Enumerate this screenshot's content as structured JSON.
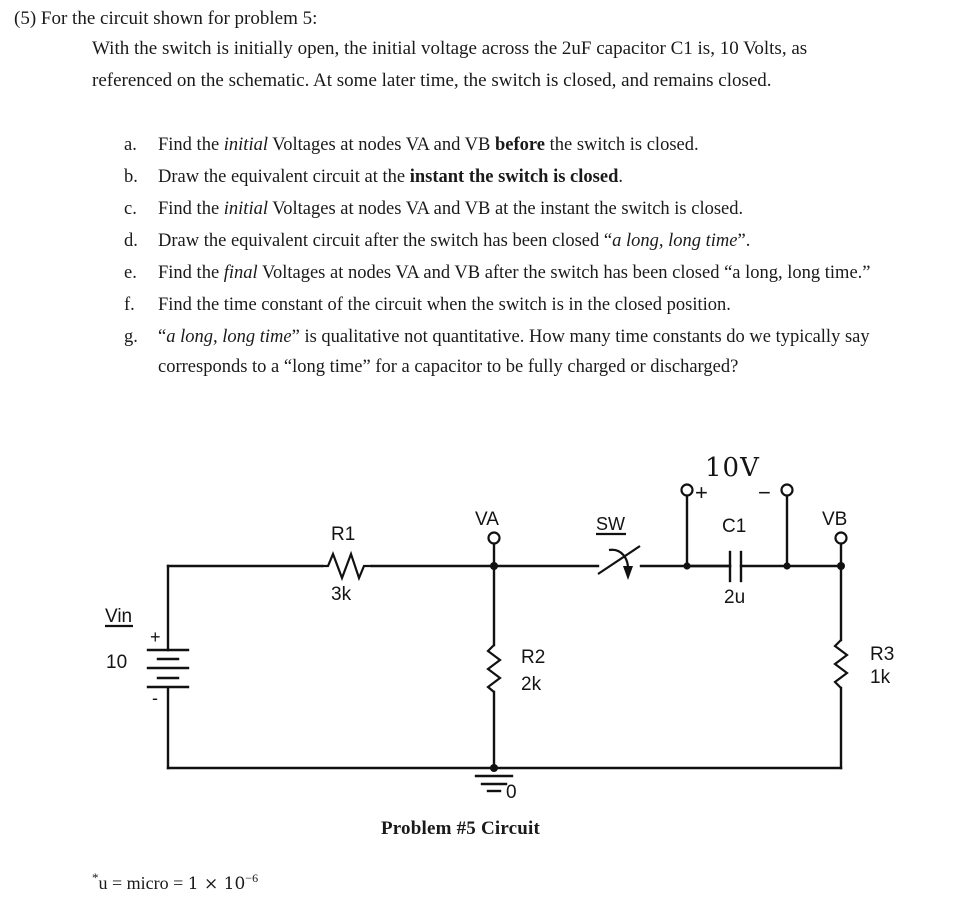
{
  "document": {
    "problem_number": "(5)",
    "heading": "(5) For the circuit shown for problem 5:",
    "intro": "With the switch is initially open, the initial voltage across the 2uF capacitor C1 is, 10 Volts, as referenced on the schematic. At some later time, the switch is closed, and remains closed.",
    "sub_questions": [
      {
        "marker": "a.",
        "text": "Find the <i>initial</i> Voltages at nodes VA and VB <b>before</b> the switch is closed."
      },
      {
        "marker": "b.",
        "text": "Draw the equivalent circuit at the <b>instant the switch is closed</b>."
      },
      {
        "marker": "c.",
        "text": "Find the <i>initial</i> Voltages at nodes VA and VB at the instant the switch is closed."
      },
      {
        "marker": "d.",
        "text": "Draw the equivalent circuit after the switch has been closed &#8220;<i>a long, long time</i>&#8221;."
      },
      {
        "marker": "e.",
        "text": "Find the <i>final</i> Voltages at nodes VA and VB after the switch has been closed &#8220;a long, long time.&#8221;"
      },
      {
        "marker": "f.",
        "text": "Find the time constant of the circuit when the switch is in the closed position."
      },
      {
        "marker": "g.",
        "text": "&#8220;<i>a long, long time</i>&#8221; is qualitative not quantitative. How many time constants do we typically say corresponds to a &#8220;long time&#8221; for a capacitor to be fully charged or discharged?"
      }
    ],
    "figure_caption": "Problem #5 Circuit",
    "footnote": {
      "star": "*",
      "text": "u = micro = ",
      "math": "1 × 10",
      "exponent": "−6"
    }
  },
  "circuit": {
    "title": "Problem #5 Circuit",
    "source": {
      "name": "Vin",
      "value": "10",
      "plus": "+",
      "minus": "-"
    },
    "capacitor_voltage_label": "10V",
    "capacitor_plus": "+",
    "capacitor_minus": "−",
    "components": [
      {
        "ref": "R1",
        "value": "3k",
        "type": "resistor"
      },
      {
        "ref": "R2",
        "value": "2k",
        "type": "resistor"
      },
      {
        "ref": "R3",
        "value": "1k",
        "type": "resistor"
      },
      {
        "ref": "C1",
        "value": "2u",
        "type": "capacitor"
      },
      {
        "ref": "SW",
        "value": "",
        "type": "switch"
      }
    ],
    "nodes": [
      {
        "name": "VA"
      },
      {
        "name": "VB"
      },
      {
        "name": "0"
      }
    ],
    "ground_label": "0",
    "colors": {
      "wire": "#111111",
      "text": "#141414",
      "background": "#ffffff"
    }
  }
}
